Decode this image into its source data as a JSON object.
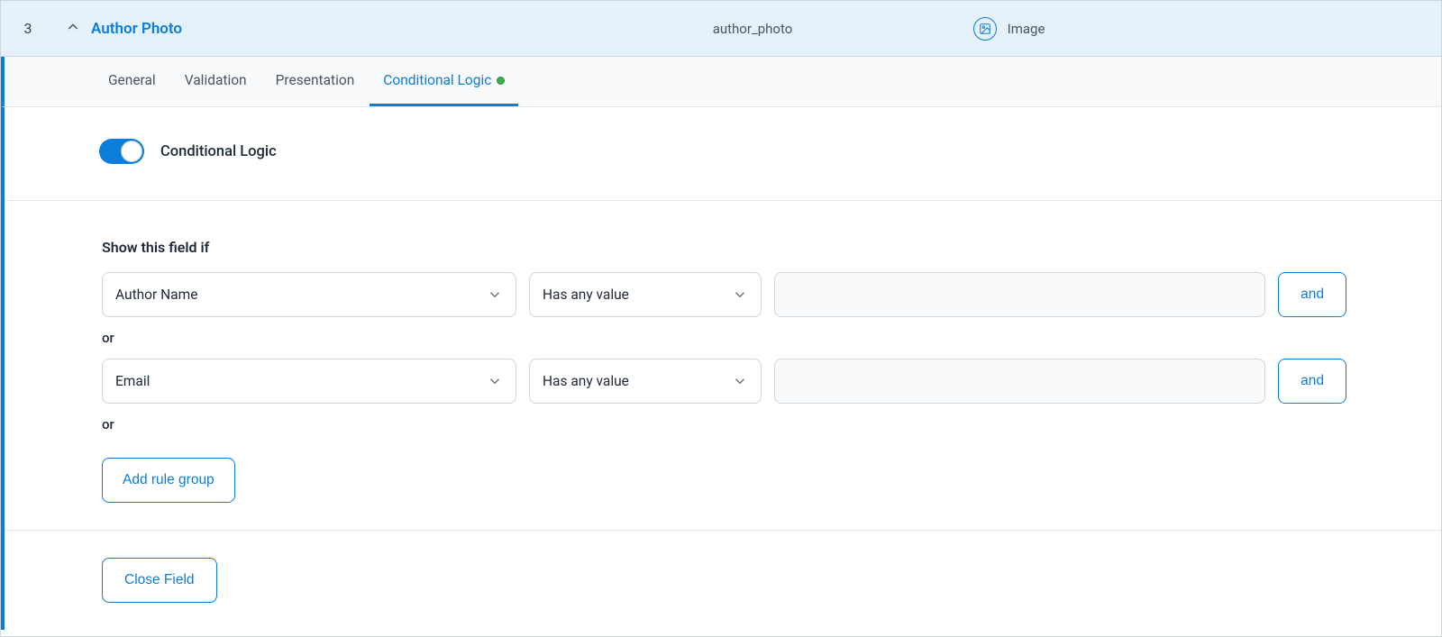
{
  "field": {
    "order": "3",
    "label": "Author Photo",
    "name": "author_photo",
    "type": "Image"
  },
  "tabs": {
    "general": "General",
    "validation": "Validation",
    "presentation": "Presentation",
    "conditional": "Conditional Logic"
  },
  "toggle": {
    "label": "Conditional Logic",
    "on": true
  },
  "rules": {
    "heading": "Show this field if",
    "or_label": "or",
    "and_label": "and",
    "add_group_label": "Add rule group",
    "rows": [
      {
        "field": "Author Name",
        "operator": "Has any value",
        "value": ""
      },
      {
        "field": "Email",
        "operator": "Has any value",
        "value": ""
      }
    ]
  },
  "footer": {
    "close_label": "Close Field"
  }
}
